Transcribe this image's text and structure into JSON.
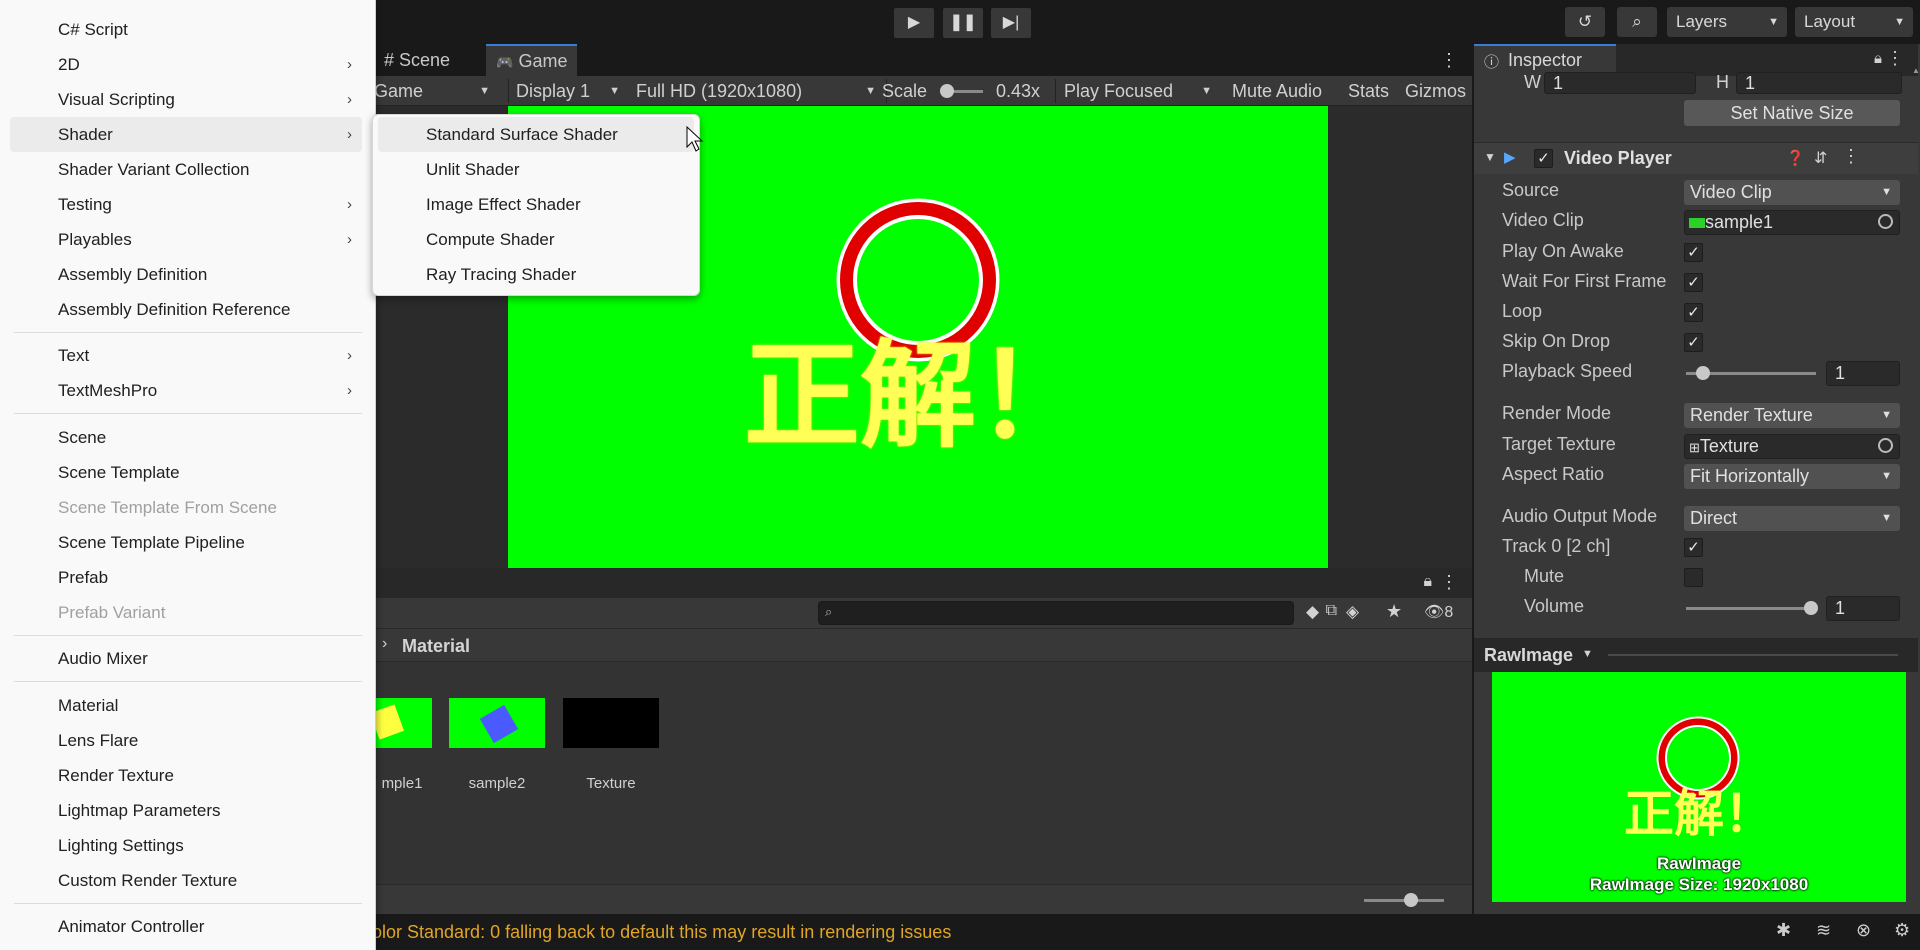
{
  "toolbar": {
    "play_icon": "play-icon",
    "pause_icon": "pause-icon",
    "step_icon": "step-icon",
    "layers_label": "Layers",
    "layout_label": "Layout"
  },
  "game_view": {
    "tabs": [
      {
        "label": "Scene",
        "icon": "#"
      },
      {
        "label": "Game",
        "icon": "gamepad"
      }
    ],
    "mode": "Game",
    "display": "Display 1",
    "resolution": "Full HD (1920x1080)",
    "scale_label": "Scale",
    "scale_value": "0.43x",
    "play_mode": "Play Focused",
    "mute_audio": "Mute Audio",
    "stats": "Stats",
    "gizmos": "Gizmos",
    "overlay_text": "正解！"
  },
  "project": {
    "breadcrumb": "Material",
    "hidden_count": "8",
    "assets": [
      {
        "label": "mple1",
        "color": "#00ff00"
      },
      {
        "label": "sample2",
        "color": "#00ff00"
      },
      {
        "label": "Texture",
        "color": "#000000"
      }
    ]
  },
  "status": {
    "message": "olor Standard: 0  falling back to default this may result in rendering issues",
    "color": "#e0a526"
  },
  "inspector": {
    "tab_label": "Inspector",
    "w_label": "W",
    "w_value": "1",
    "h_label": "H",
    "h_value": "1",
    "set_native_size": "Set Native Size",
    "component": "Video Player",
    "rows": {
      "source": {
        "label": "Source",
        "value": "Video Clip"
      },
      "video_clip": {
        "label": "Video Clip",
        "value": "sample1"
      },
      "play_on_awake": {
        "label": "Play On Awake",
        "checked": true
      },
      "wait_first_frame": {
        "label": "Wait For First Frame",
        "checked": true
      },
      "loop": {
        "label": "Loop",
        "checked": true
      },
      "skip_on_drop": {
        "label": "Skip On Drop",
        "checked": true
      },
      "playback_speed": {
        "label": "Playback Speed",
        "value": "1"
      },
      "render_mode": {
        "label": "Render Mode",
        "value": "Render Texture"
      },
      "target_texture": {
        "label": "Target Texture",
        "value": "Texture"
      },
      "aspect_ratio": {
        "label": "Aspect Ratio",
        "value": "Fit Horizontally"
      },
      "audio_output": {
        "label": "Audio Output Mode",
        "value": "Direct"
      },
      "track0": {
        "label": "Track 0 [2 ch]",
        "checked": true
      },
      "mute": {
        "label": "Mute",
        "checked": false
      },
      "volume": {
        "label": "Volume",
        "value": "1"
      }
    },
    "preview_title": "RawImage",
    "preview_name": "RawImage",
    "preview_size": "RawImage Size: 1920x1080"
  },
  "menu": {
    "items": [
      {
        "label": "C# Script"
      },
      {
        "label": "2D",
        "submenu": true
      },
      {
        "label": "Visual Scripting",
        "submenu": true
      },
      {
        "label": "Shader",
        "submenu": true,
        "hover": true
      },
      {
        "label": "Shader Variant Collection"
      },
      {
        "label": "Testing",
        "submenu": true
      },
      {
        "label": "Playables",
        "submenu": true
      },
      {
        "label": "Assembly Definition"
      },
      {
        "label": "Assembly Definition Reference"
      },
      {
        "label": "Text",
        "submenu": true
      },
      {
        "label": "TextMeshPro",
        "submenu": true
      },
      {
        "label": "Scene"
      },
      {
        "label": "Scene Template"
      },
      {
        "label": "Scene Template From Scene",
        "disabled": true
      },
      {
        "label": "Scene Template Pipeline"
      },
      {
        "label": "Prefab"
      },
      {
        "label": "Prefab Variant",
        "disabled": true
      },
      {
        "label": "Audio Mixer"
      },
      {
        "label": "Material"
      },
      {
        "label": "Lens Flare"
      },
      {
        "label": "Render Texture"
      },
      {
        "label": "Lightmap Parameters"
      },
      {
        "label": "Lighting Settings"
      },
      {
        "label": "Custom Render Texture"
      },
      {
        "label": "Animator Controller"
      }
    ],
    "submenu_items": [
      {
        "label": "Standard Surface Shader",
        "hover": true
      },
      {
        "label": "Unlit Shader"
      },
      {
        "label": "Image Effect Shader"
      },
      {
        "label": "Compute Shader"
      },
      {
        "label": "Ray Tracing Shader"
      }
    ]
  }
}
